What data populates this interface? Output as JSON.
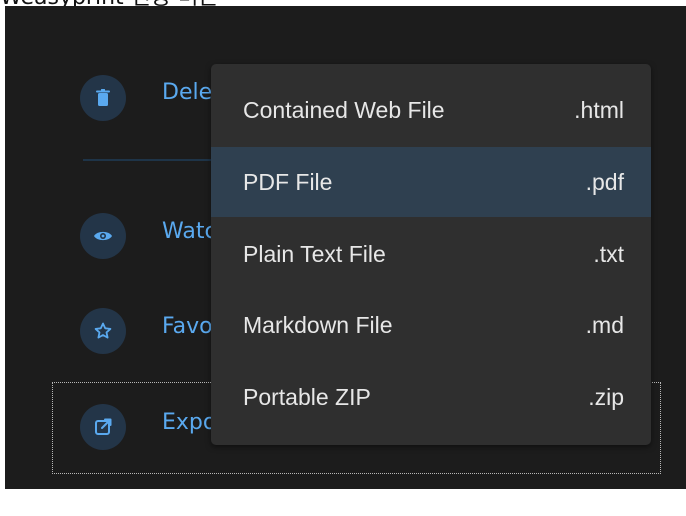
{
  "caption": {
    "text": "Weasyprint 전용 버튼"
  },
  "actions": [
    {
      "label": "Delete",
      "icon": "trash-icon"
    },
    {
      "label": "Watch",
      "icon": "eye-icon"
    },
    {
      "label": "Favorite",
      "icon": "star-icon"
    },
    {
      "label": "Export",
      "icon": "external-link-icon"
    }
  ],
  "export_menu": {
    "items": [
      {
        "label": "Contained Web File",
        "ext": ".html",
        "highlighted": false
      },
      {
        "label": "PDF File",
        "ext": ".pdf",
        "highlighted": true
      },
      {
        "label": "Plain Text File",
        "ext": ".txt",
        "highlighted": false
      },
      {
        "label": "Markdown File",
        "ext": ".md",
        "highlighted": false
      },
      {
        "label": "Portable ZIP",
        "ext": ".zip",
        "highlighted": false
      }
    ]
  },
  "colors": {
    "panel_bg": "#1c1c1c",
    "menu_bg": "#2f2f2f",
    "menu_highlight": "#2f4050",
    "link_blue": "#5aa9ef",
    "icon_circle": "#233548"
  }
}
